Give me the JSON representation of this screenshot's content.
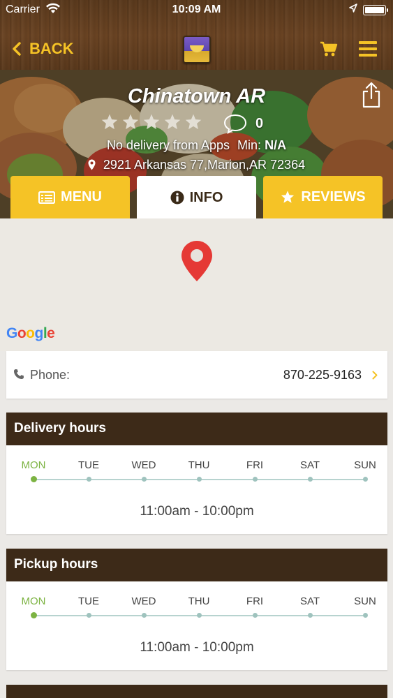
{
  "status": {
    "carrier": "Carrier",
    "time": "10:09 AM"
  },
  "nav": {
    "back_label": "BACK"
  },
  "restaurant": {
    "name": "Chinatown AR",
    "rating": 0,
    "review_count": "0",
    "delivery_text": "No delivery from Apps",
    "min_label": "Min:",
    "min_value": "N/A",
    "address": "2921 Arkansas 77,Marion,AR 72364"
  },
  "tabs": [
    {
      "label": "MENU",
      "icon": "menu-card-icon"
    },
    {
      "label": "INFO",
      "icon": "info-icon"
    },
    {
      "label": "REVIEWS",
      "icon": "star-icon"
    }
  ],
  "map": {
    "attribution": "Google"
  },
  "phone": {
    "label": "Phone:",
    "value": "870-225-9163"
  },
  "delivery_hours": {
    "title": "Delivery hours",
    "days": [
      "MON",
      "TUE",
      "WED",
      "THU",
      "FRI",
      "SAT",
      "SUN"
    ],
    "selected": "MON",
    "hours": "11:00am - 10:00pm"
  },
  "pickup_hours": {
    "title": "Pickup hours",
    "days": [
      "MON",
      "TUE",
      "WED",
      "THU",
      "FRI",
      "SAT",
      "SUN"
    ],
    "selected": "MON",
    "hours": "11:00am - 10:00pm"
  },
  "colors": {
    "accent": "#f5c326",
    "header_brown": "#5b3a1d",
    "section_header": "#3d2a18",
    "active_day": "#7cb342",
    "marker_red": "#e53935"
  }
}
